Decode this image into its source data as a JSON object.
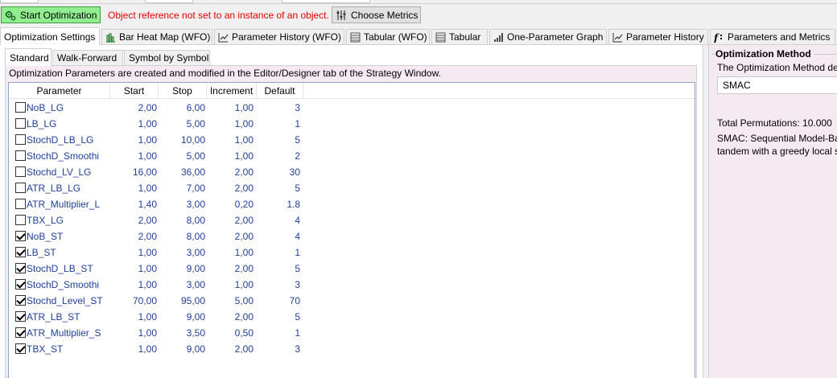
{
  "toolbar": {
    "start_label": "Start Optimization",
    "error_message": "Object reference not set to an instance of an object.",
    "metrics_label": "Choose Metrics"
  },
  "tabs": [
    {
      "label": "Optimization Settings",
      "icon": "none"
    },
    {
      "label": "Bar Heat Map (WFO)",
      "icon": "heatmap-icon"
    },
    {
      "label": "Parameter History (WFO)",
      "icon": "line-chart-icon"
    },
    {
      "label": "Tabular (WFO)",
      "icon": "table-icon"
    },
    {
      "label": "Tabular",
      "icon": "table-icon"
    },
    {
      "label": "One-Parameter Graph",
      "icon": "bar-chart-icon"
    },
    {
      "label": "Parameter History",
      "icon": "line-chart-icon"
    },
    {
      "label": "Parameters and Metrics",
      "icon": "function-icon"
    }
  ],
  "subtabs": [
    "Standard",
    "Walk-Forward",
    "Symbol by Symbol"
  ],
  "info_text": "Optimization Parameters are created and modified in the Editor/Designer tab of the Strategy Window.",
  "grid": {
    "columns": [
      "Parameter",
      "Start",
      "Stop",
      "Increment",
      "Default"
    ],
    "rows": [
      {
        "name": "NoB_LG",
        "start": "2,00",
        "stop": "6,00",
        "increment": "1,00",
        "default": "3",
        "checked": false
      },
      {
        "name": "LB_LG",
        "start": "1,00",
        "stop": "5,00",
        "increment": "1,00",
        "default": "1",
        "checked": false
      },
      {
        "name": "StochD_LB_LG",
        "start": "1,00",
        "stop": "10,00",
        "increment": "1,00",
        "default": "5",
        "checked": false
      },
      {
        "name": "StochD_Smoothi",
        "start": "1,00",
        "stop": "5,00",
        "increment": "1,00",
        "default": "2",
        "checked": false
      },
      {
        "name": "Stochd_LV_LG",
        "start": "16,00",
        "stop": "36,00",
        "increment": "2,00",
        "default": "30",
        "checked": false
      },
      {
        "name": "ATR_LB_LG",
        "start": "1,00",
        "stop": "7,00",
        "increment": "2,00",
        "default": "5",
        "checked": false
      },
      {
        "name": "ATR_Multiplier_L",
        "start": "1,40",
        "stop": "3,00",
        "increment": "0,20",
        "default": "1.8",
        "checked": false
      },
      {
        "name": "TBX_LG",
        "start": "2,00",
        "stop": "8,00",
        "increment": "2,00",
        "default": "4",
        "checked": false
      },
      {
        "name": "NoB_ST",
        "start": "2,00",
        "stop": "8,00",
        "increment": "2,00",
        "default": "4",
        "checked": true
      },
      {
        "name": "LB_ST",
        "start": "1,00",
        "stop": "3,00",
        "increment": "1,00",
        "default": "1",
        "checked": true
      },
      {
        "name": "StochD_LB_ST",
        "start": "1,00",
        "stop": "9,00",
        "increment": "2,00",
        "default": "5",
        "checked": true
      },
      {
        "name": "StochD_Smoothi",
        "start": "1,00",
        "stop": "3,00",
        "increment": "1,00",
        "default": "3",
        "checked": true
      },
      {
        "name": "Stochd_Level_ST",
        "start": "70,00",
        "stop": "95,00",
        "increment": "5,00",
        "default": "70",
        "checked": true
      },
      {
        "name": "ATR_LB_ST",
        "start": "1,00",
        "stop": "9,00",
        "increment": "2,00",
        "default": "5",
        "checked": true
      },
      {
        "name": "ATR_Multiplier_S",
        "start": "1,00",
        "stop": "3,50",
        "increment": "0,50",
        "default": "1",
        "checked": true
      },
      {
        "name": "TBX_ST",
        "start": "1,00",
        "stop": "9,00",
        "increment": "2,00",
        "default": "3",
        "checked": true
      }
    ]
  },
  "right": {
    "group_title": "Optimization Method",
    "description": "The Optimization Method de",
    "method_value": "SMAC",
    "total_permutations": "Total Permutations: 10.000",
    "smac_line1": "SMAC: Sequential Model-Ba",
    "smac_line2": "tandem with a greedy local s"
  },
  "colors": {
    "start_button": "#90ee90",
    "error_text": "#e00000",
    "value_text": "#1f3f99",
    "panel_bg": "#f6eaf2",
    "grid_border": "#8aa6c8"
  }
}
